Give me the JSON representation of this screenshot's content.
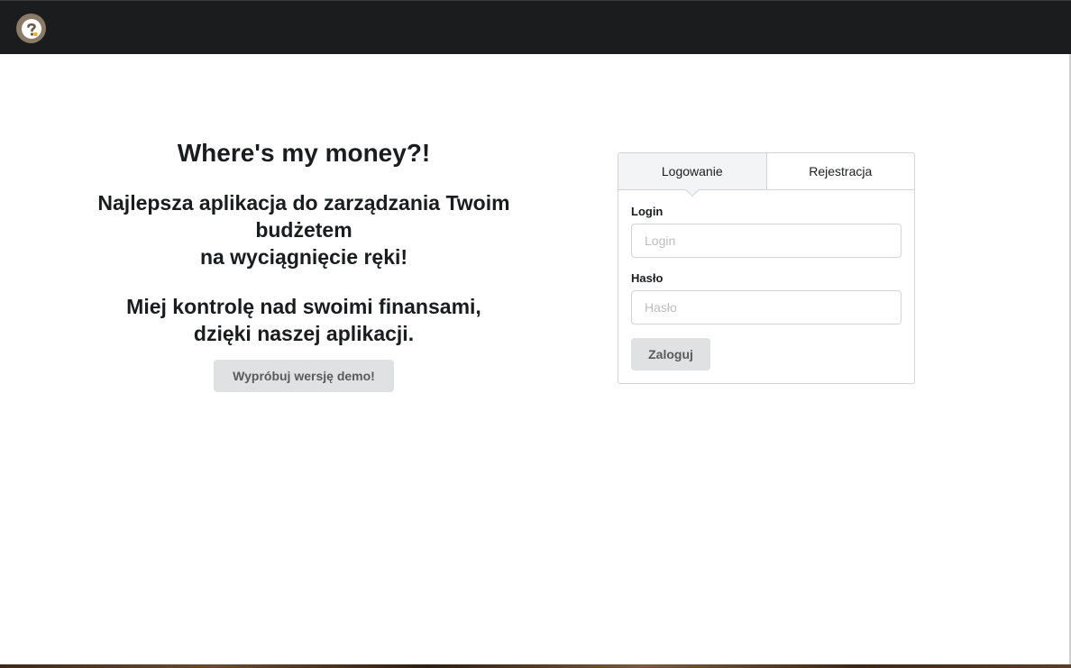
{
  "navbar": {
    "logo_icon": "question-mark-logo-icon"
  },
  "hero": {
    "title": "Where's my money?!",
    "tagline_line1": "Najlepsza aplikacja do zarządzania Twoim budżetem",
    "tagline_line2": "na wyciągnięcie ręki!",
    "subtitle_line1": "Miej kontrolę nad swoimi finansami,",
    "subtitle_line2": "dzięki naszej aplikacji.",
    "demo_button": "Wypróbuj wersję demo!"
  },
  "auth": {
    "tabs": [
      {
        "label": "Logowanie",
        "active": true
      },
      {
        "label": "Rejestracja",
        "active": false
      }
    ],
    "login_label": "Login",
    "login_placeholder": "Login",
    "password_label": "Hasło",
    "password_placeholder": "Hasło",
    "submit_label": "Zaloguj"
  },
  "colors": {
    "navbar": "#1b1c1d",
    "button_bg": "#e0e1e2",
    "border": "#d4d4d5"
  }
}
